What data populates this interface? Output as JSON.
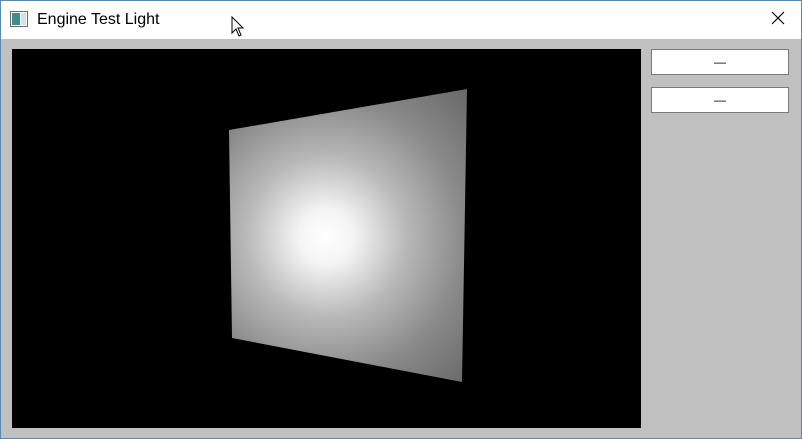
{
  "window": {
    "title": "Engine Test Light",
    "icon": "app-window-icon",
    "close_icon": "close-icon"
  },
  "viewport": {
    "description_icon": "lit-quad-render",
    "background_color": "#000000",
    "light_color": "#ffffff"
  },
  "sidebar": {
    "buttons": [
      {
        "label": "—"
      },
      {
        "label": "—"
      }
    ]
  },
  "cursor": {
    "icon": "arrow-cursor-icon"
  }
}
